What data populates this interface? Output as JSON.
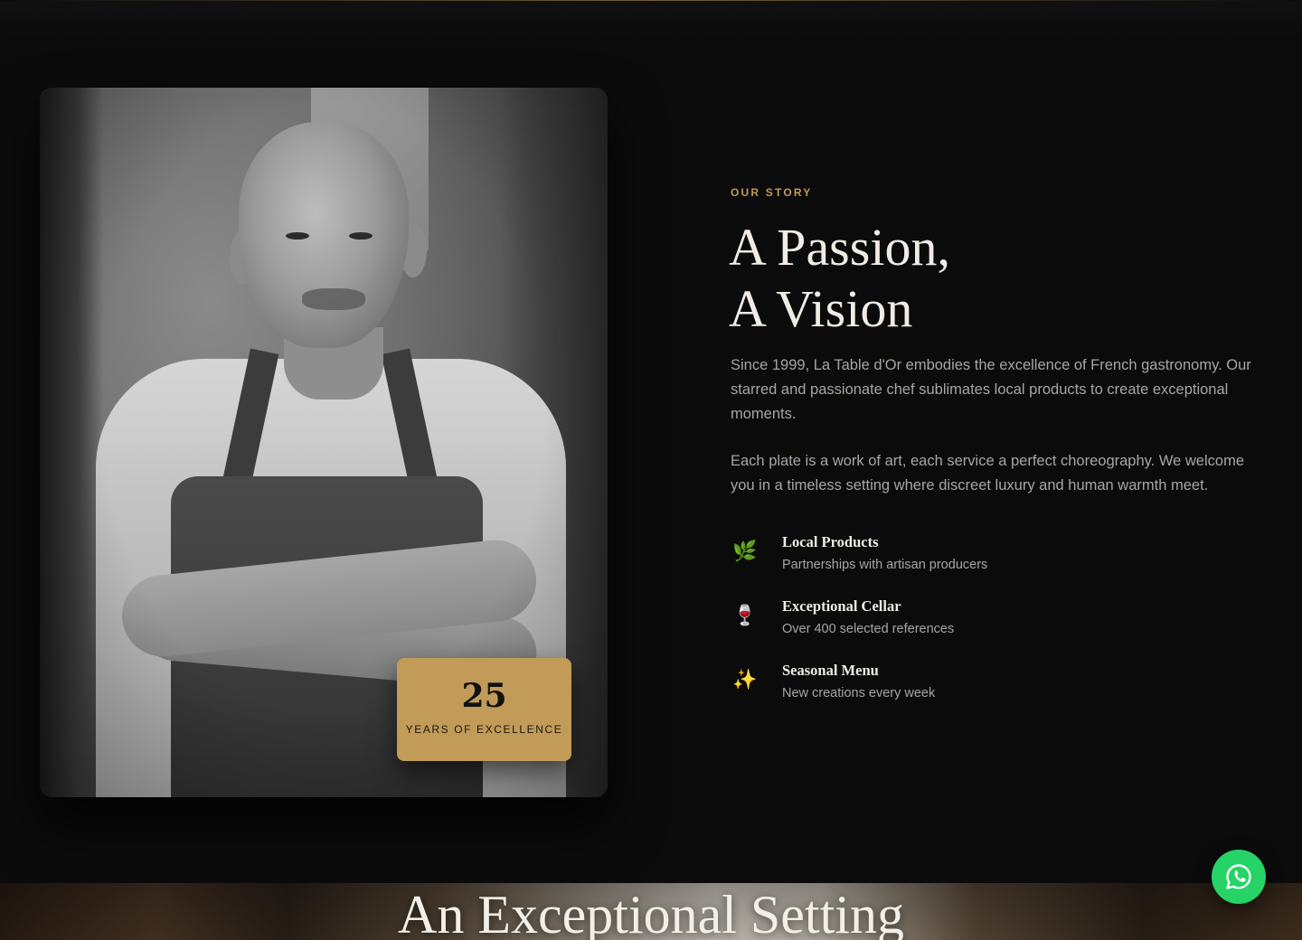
{
  "about": {
    "eyebrow": "OUR STORY",
    "headline_line1": "A Passion,",
    "headline_line2": "A Vision",
    "paragraph1": "Since 1999, La Table d'Or embodies the excellence of French gastronomy. Our starred and passionate chef sublimates local products to create exceptional moments.",
    "paragraph2": "Each plate is a work of art, each service a perfect choreography. We welcome you in a timeless setting where discreet luxury and human warmth meet."
  },
  "badge": {
    "number": "25",
    "label": "YEARS OF EXCELLENCE"
  },
  "features": [
    {
      "icon": "herb-icon",
      "glyph": "🌿",
      "title": "Local Products",
      "desc": "Partnerships with artisan producers"
    },
    {
      "icon": "wine-glass-icon",
      "glyph": "🍷",
      "title": "Exceptional Cellar",
      "desc": "Over 400 selected references"
    },
    {
      "icon": "sparkles-icon",
      "glyph": "✨",
      "title": "Seasonal Menu",
      "desc": "New creations every week"
    }
  ],
  "next_section": {
    "title": "An Exceptional Setting"
  },
  "colors": {
    "background": "#0b0b0c",
    "accent_gold": "#c19b57",
    "heading_text": "#f0ece4",
    "body_text": "#a9a6a1",
    "whatsapp_green": "#25d366"
  },
  "whatsapp_button": {
    "icon": "whatsapp-icon"
  }
}
